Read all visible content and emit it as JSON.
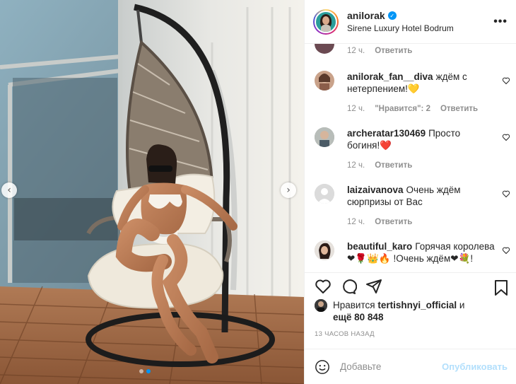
{
  "post": {
    "username": "anilorak",
    "verified_icon": "verified-badge-icon",
    "location": "Sirene Luxury Hotel Bodrum",
    "more_label": "•••"
  },
  "comments": [
    {
      "username": "",
      "text": "",
      "time": "12 ч.",
      "likes_label": "",
      "reply_label": "Ответить"
    },
    {
      "username": "anilorak_fan__diva",
      "text": "ждём с нетерпением!💛",
      "time": "12 ч.",
      "likes_label": "\"Нравится\": 2",
      "reply_label": "Ответить"
    },
    {
      "username": "archeratar130469",
      "text": "Просто богиня!❤️",
      "time": "12 ч.",
      "likes_label": "",
      "reply_label": "Ответить"
    },
    {
      "username": "laizaivanova",
      "text": "Очень ждём сюрпризы от Вас",
      "time": "12 ч.",
      "likes_label": "",
      "reply_label": "Ответить"
    },
    {
      "username": "beautiful_karo",
      "text": "Горячая королева ❤🌹👑🔥 !Очень ждём❤💐!",
      "time": "",
      "likes_label": "",
      "reply_label": ""
    }
  ],
  "likes": {
    "prefix": "Нравится",
    "user": "tertishnyi_official",
    "and": "и",
    "more": "ещё 80 848"
  },
  "time_ago": "13 ЧАСОВ НАЗАД",
  "add_comment": {
    "placeholder": "Добавьте",
    "publish_label": "Опубликовать"
  },
  "carousel": {
    "slide_count": 2,
    "active_slide": 2
  },
  "colors": {
    "accent": "#0095f6",
    "publish_disabled": "#b2dffc",
    "meta_gray": "#8e8e8e"
  }
}
